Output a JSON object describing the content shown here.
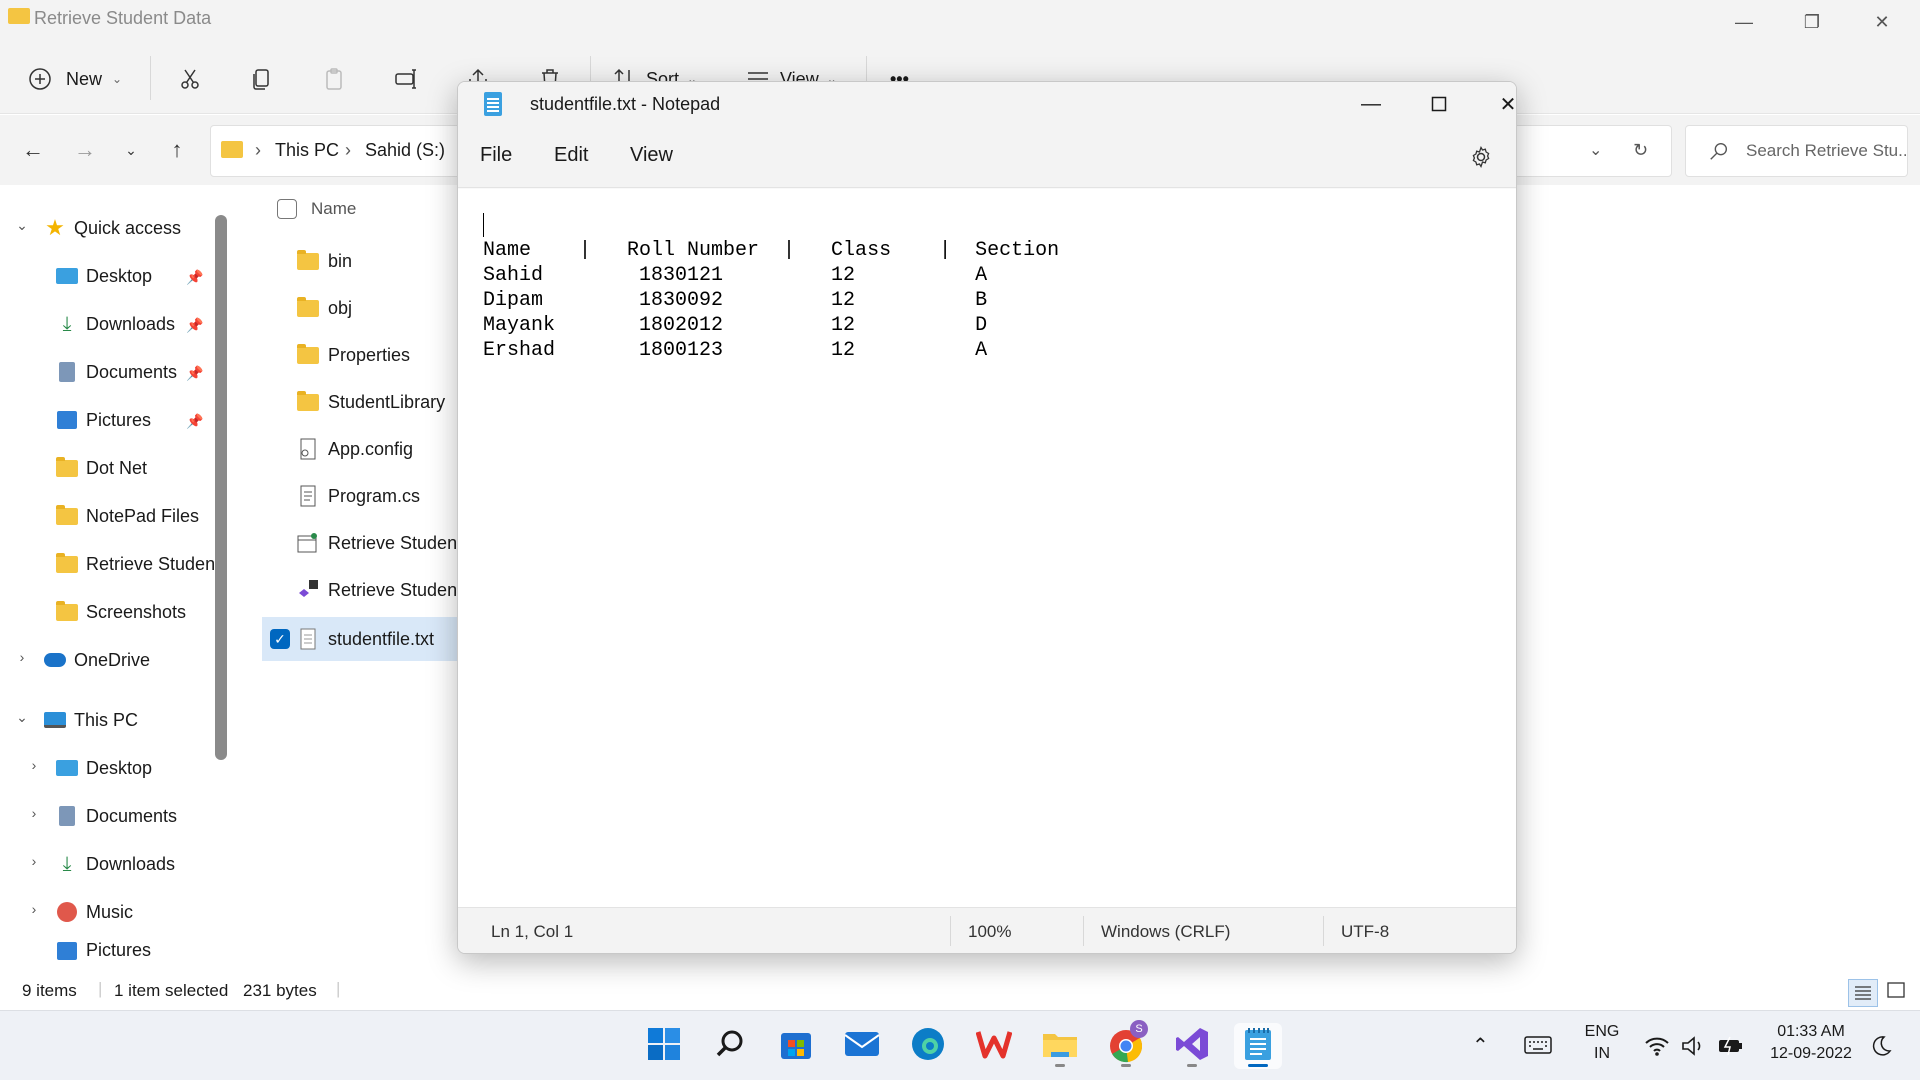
{
  "explorer": {
    "title": "Retrieve Student Data",
    "toolbar": {
      "new_label": "New",
      "sort_label": "Sort",
      "view_label": "View",
      "more_label": "•••"
    },
    "breadcrumb": [
      "This PC",
      "Sahid (S:)"
    ],
    "search_placeholder": "Search Retrieve Stu...",
    "column_name": "Name",
    "sidebar": {
      "quick_access": "Quick access",
      "quick_items": [
        "Desktop",
        "Downloads",
        "Documents",
        "Pictures",
        "Dot Net",
        "NotePad Files",
        "Retrieve Studen",
        "Screenshots"
      ],
      "onedrive": "OneDrive",
      "this_pc": "This PC",
      "pc_items": [
        "Desktop",
        "Documents",
        "Downloads",
        "Music",
        "Pictures"
      ]
    },
    "files": [
      {
        "name": "bin",
        "type": "folder"
      },
      {
        "name": "obj",
        "type": "folder"
      },
      {
        "name": "Properties",
        "type": "folder"
      },
      {
        "name": "StudentLibrary",
        "type": "folder"
      },
      {
        "name": "App.config",
        "type": "config"
      },
      {
        "name": "Program.cs",
        "type": "cs"
      },
      {
        "name": "Retrieve Student D",
        "type": "project"
      },
      {
        "name": "Retrieve Student D",
        "type": "solution"
      },
      {
        "name": "studentfile.txt",
        "type": "text",
        "selected": true
      }
    ],
    "status": {
      "items": "9 items",
      "selected": "1 item selected",
      "size": "231 bytes"
    }
  },
  "notepad": {
    "title": "studentfile.txt - Notepad",
    "menu": [
      "File",
      "Edit",
      "View"
    ],
    "content": "Name    |   Roll Number  |   Class    |  Section\nSahid        1830121         12          A\nDipam        1830092         12          B\nMayank       1802012         12          D\nErshad       1800123         12          A",
    "status": {
      "position": "Ln 1, Col 1",
      "zoom": "100%",
      "line_ending": "Windows (CRLF)",
      "encoding": "UTF-8"
    }
  },
  "taskbar": {
    "language": "ENG",
    "region": "IN",
    "time": "01:33 AM",
    "date": "12-09-2022",
    "chrome_badge": "S"
  },
  "colors": {
    "accent": "#0067c0",
    "folder": "#f4c542",
    "selection": "#d9e8f8"
  }
}
